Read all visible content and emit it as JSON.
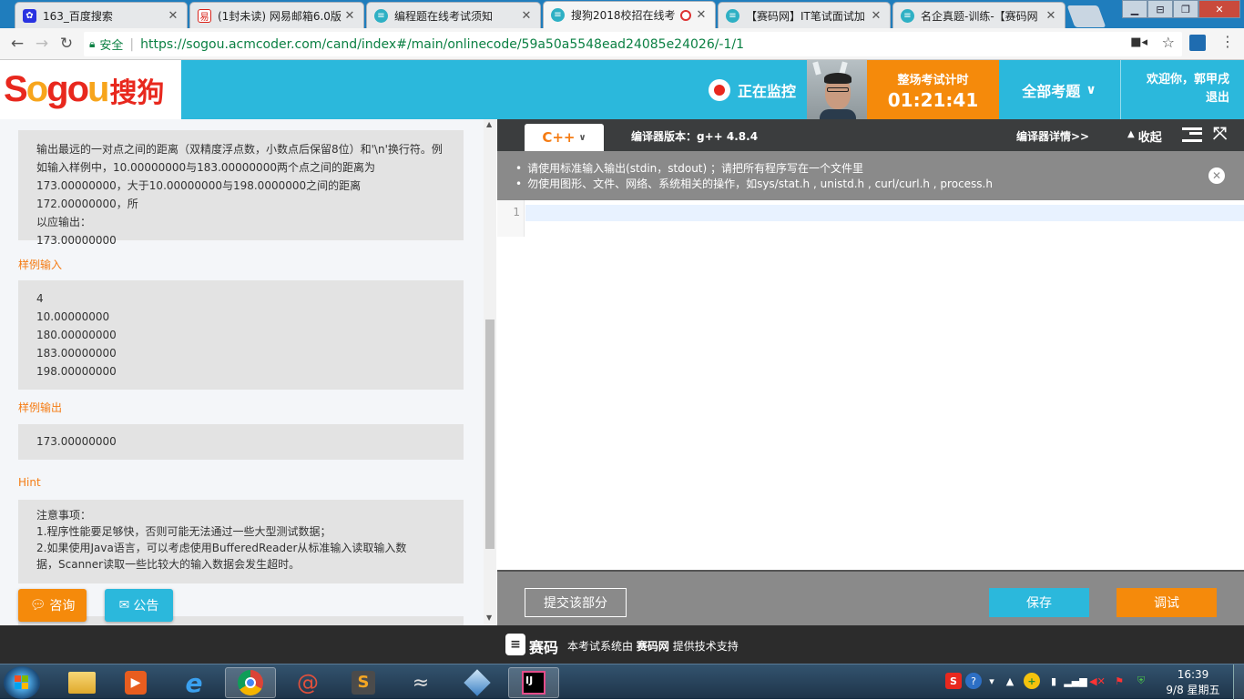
{
  "browser": {
    "tabs": [
      {
        "title": "163_百度搜索",
        "favicon": "baidu-paw-icon",
        "color": "#2932e1"
      },
      {
        "title": "(1封未读) 网易邮箱6.0版",
        "favicon": "netease-mail-icon",
        "color": "#d9241b"
      },
      {
        "title": "编程题在线考试须知",
        "favicon": "acmcoder-icon",
        "color": "#2eb0c4"
      },
      {
        "title": "搜狗2018校招在线考",
        "favicon": "acmcoder-icon",
        "color": "#2eb0c4",
        "active": true
      },
      {
        "title": "【赛码网】IT笔试面试加",
        "favicon": "acmcoder-icon",
        "color": "#2eb0c4"
      },
      {
        "title": "名企真题-训练-【赛码网",
        "favicon": "acmcoder-icon",
        "color": "#2eb0c4"
      }
    ],
    "secure_label": "安全",
    "url": "https://sogou.acmcoder.com/cand/index#/main/onlinecode/59a50a5548ead24085e24026/-1/1"
  },
  "header": {
    "logo_text": "Sogou",
    "logo_cn": "搜狗",
    "monitor_label": "正在监控",
    "timer_title": "整场考试计时",
    "timer_value": "01:21:41",
    "all_questions_label": "全部考题",
    "welcome_line1": "欢迎你，郭甲戌",
    "welcome_line2": "退出"
  },
  "problem": {
    "output_desc_lines": [
      "输出最远的一对点之间的距离（双精度浮点数，小数点后保留8位）和'\\n'换行符。例",
      "如输入样例中，10.00000000与183.00000000两个点之间的距离为",
      "173.00000000，大于10.00000000与198.0000000之间的距离172.00000000，所",
      "以应输出：",
      "173.00000000"
    ],
    "sample_input_title": "样例输入",
    "sample_input_lines": [
      "4",
      "10.00000000",
      "180.00000000",
      "183.00000000",
      "198.00000000"
    ],
    "sample_output_title": "样例输出",
    "sample_output": "173.00000000",
    "hint_title": "Hint",
    "hint_lines": [
      "注意事项：",
      "1.程序性能要足够快，否则可能无法通过一些大型测试数据；",
      "2.如果使用Java语言，可以考虑使用BufferedReader从标准输入读取输入数",
      "据，Scanner读取一些比较大的输入数据会发生超时。"
    ],
    "consult_label": "咨询",
    "announce_label": "公告"
  },
  "editor": {
    "language": "C++",
    "compiler_version": "编译器版本：g++ 4.8.4",
    "compiler_details_label": "编译器详情>>",
    "collapse_label": "收起",
    "notices": [
      "请使用标准输入输出(stdin，stdout) ；请把所有程序写在一个文件里",
      "勿使用图形、文件、网络、系统相关的操作，如sys/stat.h , unistd.h , curl/curl.h , process.h"
    ],
    "line_number": "1",
    "submit_part_label": "提交该部分",
    "save_label": "保存",
    "debug_label": "调试"
  },
  "footer": {
    "brand": "赛码",
    "text_prefix": "本考试系统由",
    "text_brand": "赛码网",
    "text_suffix": "提供技术支持"
  },
  "taskbar": {
    "apps": [
      "file-explorer-icon",
      "media-player-icon",
      "internet-explorer-icon",
      "chrome-icon",
      "snail-icon",
      "sublime-text-icon",
      "mysql-workbench-icon",
      "virtualbox-icon",
      "intellij-idea-icon"
    ],
    "time": "16:39",
    "date": "9/8 星期五"
  },
  "colors": {
    "header_blue": "#2bb8dc",
    "orange": "#f58a0b",
    "section_orange": "#f57c14"
  }
}
